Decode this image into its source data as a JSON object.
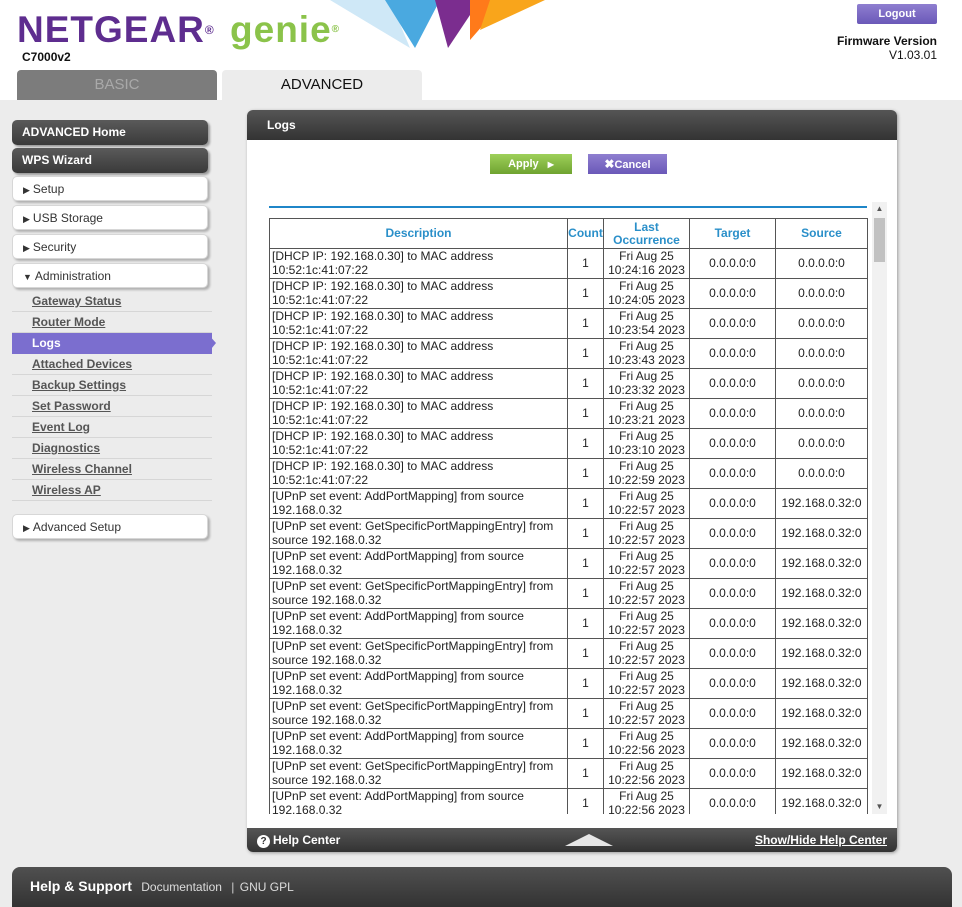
{
  "header": {
    "brand": "NETGEAR",
    "brand_mark": "®",
    "product": "genie",
    "product_mark": "®",
    "model": "C7000v2",
    "logout_label": "Logout",
    "firmware_label": "Firmware Version",
    "firmware_value": "V1.03.01",
    "tabs": [
      {
        "label": "BASIC"
      },
      {
        "label": "ADVANCED"
      }
    ]
  },
  "sidebar": {
    "advanced_home": "ADVANCED Home",
    "wps_wizard": "WPS Wizard",
    "setup": "Setup",
    "usb_storage": "USB Storage",
    "security": "Security",
    "administration": "Administration",
    "sub_items": [
      {
        "label": "Gateway Status"
      },
      {
        "label": "Router Mode"
      },
      {
        "label": "Logs"
      },
      {
        "label": "Attached Devices"
      },
      {
        "label": "Backup Settings"
      },
      {
        "label": "Set Password"
      },
      {
        "label": "Event Log"
      },
      {
        "label": "Diagnostics"
      },
      {
        "label": "Wireless Channel"
      },
      {
        "label": "Wireless AP"
      }
    ],
    "advanced_setup": "Advanced Setup"
  },
  "panel": {
    "title": "Logs",
    "apply_label": "Apply",
    "cancel_label": "Cancel"
  },
  "table": {
    "headers": {
      "description": "Description",
      "count": "Count",
      "last_occurrence": "Last Occurrence",
      "target": "Target",
      "source": "Source"
    },
    "rows": [
      {
        "desc": "[DHCP IP: 192.168.0.30] to MAC address 10:52:1c:41:07:22",
        "count": "1",
        "date": "Fri Aug 25",
        "time": "10:24:16 2023",
        "target": "0.0.0.0:0",
        "source": "0.0.0.0:0"
      },
      {
        "desc": "[DHCP IP: 192.168.0.30] to MAC address 10:52:1c:41:07:22",
        "count": "1",
        "date": "Fri Aug 25",
        "time": "10:24:05 2023",
        "target": "0.0.0.0:0",
        "source": "0.0.0.0:0"
      },
      {
        "desc": "[DHCP IP: 192.168.0.30] to MAC address 10:52:1c:41:07:22",
        "count": "1",
        "date": "Fri Aug 25",
        "time": "10:23:54 2023",
        "target": "0.0.0.0:0",
        "source": "0.0.0.0:0"
      },
      {
        "desc": "[DHCP IP: 192.168.0.30] to MAC address 10:52:1c:41:07:22",
        "count": "1",
        "date": "Fri Aug 25",
        "time": "10:23:43 2023",
        "target": "0.0.0.0:0",
        "source": "0.0.0.0:0"
      },
      {
        "desc": "[DHCP IP: 192.168.0.30] to MAC address 10:52:1c:41:07:22",
        "count": "1",
        "date": "Fri Aug 25",
        "time": "10:23:32 2023",
        "target": "0.0.0.0:0",
        "source": "0.0.0.0:0"
      },
      {
        "desc": "[DHCP IP: 192.168.0.30] to MAC address 10:52:1c:41:07:22",
        "count": "1",
        "date": "Fri Aug 25",
        "time": "10:23:21 2023",
        "target": "0.0.0.0:0",
        "source": "0.0.0.0:0"
      },
      {
        "desc": "[DHCP IP: 192.168.0.30] to MAC address 10:52:1c:41:07:22",
        "count": "1",
        "date": "Fri Aug 25",
        "time": "10:23:10 2023",
        "target": "0.0.0.0:0",
        "source": "0.0.0.0:0"
      },
      {
        "desc": "[DHCP IP: 192.168.0.30] to MAC address 10:52:1c:41:07:22",
        "count": "1",
        "date": "Fri Aug 25",
        "time": "10:22:59 2023",
        "target": "0.0.0.0:0",
        "source": "0.0.0.0:0"
      },
      {
        "desc": "[UPnP set event: AddPortMapping] from source 192.168.0.32",
        "count": "1",
        "date": "Fri Aug 25",
        "time": "10:22:57 2023",
        "target": "0.0.0.0:0",
        "source": "192.168.0.32:0"
      },
      {
        "desc": "[UPnP set event: GetSpecificPortMappingEntry] from source 192.168.0.32",
        "count": "1",
        "date": "Fri Aug 25",
        "time": "10:22:57 2023",
        "target": "0.0.0.0:0",
        "source": "192.168.0.32:0"
      },
      {
        "desc": "[UPnP set event: AddPortMapping] from source 192.168.0.32",
        "count": "1",
        "date": "Fri Aug 25",
        "time": "10:22:57 2023",
        "target": "0.0.0.0:0",
        "source": "192.168.0.32:0"
      },
      {
        "desc": "[UPnP set event: GetSpecificPortMappingEntry] from source 192.168.0.32",
        "count": "1",
        "date": "Fri Aug 25",
        "time": "10:22:57 2023",
        "target": "0.0.0.0:0",
        "source": "192.168.0.32:0"
      },
      {
        "desc": "[UPnP set event: AddPortMapping] from source 192.168.0.32",
        "count": "1",
        "date": "Fri Aug 25",
        "time": "10:22:57 2023",
        "target": "0.0.0.0:0",
        "source": "192.168.0.32:0"
      },
      {
        "desc": "[UPnP set event: GetSpecificPortMappingEntry] from source 192.168.0.32",
        "count": "1",
        "date": "Fri Aug 25",
        "time": "10:22:57 2023",
        "target": "0.0.0.0:0",
        "source": "192.168.0.32:0"
      },
      {
        "desc": "[UPnP set event: AddPortMapping] from source 192.168.0.32",
        "count": "1",
        "date": "Fri Aug 25",
        "time": "10:22:57 2023",
        "target": "0.0.0.0:0",
        "source": "192.168.0.32:0"
      },
      {
        "desc": "[UPnP set event: GetSpecificPortMappingEntry] from source 192.168.0.32",
        "count": "1",
        "date": "Fri Aug 25",
        "time": "10:22:57 2023",
        "target": "0.0.0.0:0",
        "source": "192.168.0.32:0"
      },
      {
        "desc": "[UPnP set event: AddPortMapping] from source 192.168.0.32",
        "count": "1",
        "date": "Fri Aug 25",
        "time": "10:22:56 2023",
        "target": "0.0.0.0:0",
        "source": "192.168.0.32:0"
      },
      {
        "desc": "[UPnP set event: GetSpecificPortMappingEntry] from source 192.168.0.32",
        "count": "1",
        "date": "Fri Aug 25",
        "time": "10:22:56 2023",
        "target": "0.0.0.0:0",
        "source": "192.168.0.32:0"
      },
      {
        "desc": "[UPnP set event: AddPortMapping] from source 192.168.0.32",
        "count": "1",
        "date": "Fri Aug 25",
        "time": "10:22:56 2023",
        "target": "0.0.0.0:0",
        "source": "192.168.0.32:0"
      }
    ]
  },
  "help_bar": {
    "help_center": "Help Center",
    "show_hide": "Show/Hide Help Center"
  },
  "footer": {
    "help_support": "Help & Support",
    "documentation": "Documentation",
    "separator": "|",
    "gnu_gpl": "GNU GPL"
  },
  "colors": {
    "brand_purple": "#5e2d8f",
    "genie_green": "#8bc34a",
    "accent_blue": "#1f86c8",
    "selected_purple": "#7b6ecf",
    "apply_green": "#7fb83c"
  }
}
